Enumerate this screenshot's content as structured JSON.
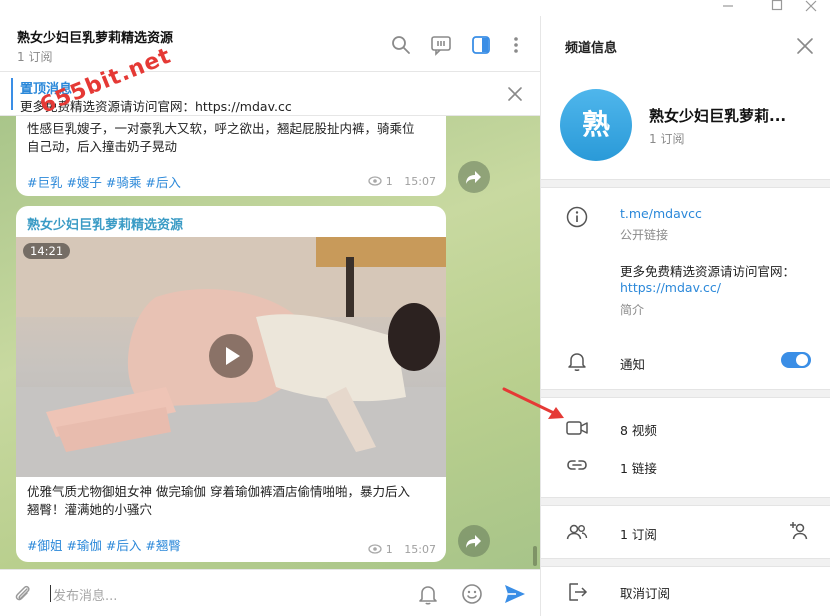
{
  "channel": {
    "title": "熟女少妇巨乳萝莉精选资源",
    "subscribers": "1 订阅",
    "short_name": "熟女少妇巨乳萝莉...",
    "avatar_letter": "熟"
  },
  "pinned": {
    "title": "置顶消息",
    "text": "更多免费精选资源请访问官网：https://mdav.cc"
  },
  "messages": [
    {
      "text_lines": [
        "性感巨乳嫂子，一对豪乳大又软，呼之欲出，翘起屁股扯内裤，骑乘位",
        "自己动，后入撞击奶子晃动"
      ],
      "tags": "#巨乳 #嫂子 #骑乘 #后入",
      "views": "1",
      "time": "15:07"
    },
    {
      "sender": "熟女少妇巨乳萝莉精选资源",
      "duration": "14:21",
      "text_lines": [
        "优雅气质尤物御姐女神 做完瑜伽 穿着瑜伽裤酒店偷情啪啪，暴力后入",
        "翘臀！灌满她的小骚穴"
      ],
      "tags": "#御姐 #瑜伽 #后入 #翘臀",
      "views": "1",
      "time": "15:07"
    }
  ],
  "composer": {
    "placeholder": "发布消息..."
  },
  "info_panel": {
    "title": "频道信息",
    "link": "t.me/mdavcc",
    "link_caption": "公开链接",
    "description": "更多免费精选资源请访问官网：",
    "description_link": "https://mdav.cc/",
    "description_caption": "简介",
    "notifications_label": "通知",
    "notifications_on": true,
    "videos": "8 视频",
    "links": "1 链接",
    "subscribers": "1 订阅",
    "leave": "取消订阅"
  },
  "watermark": "655bit.net",
  "colors": {
    "accent": "#3a8ee6",
    "link": "#2b88d9",
    "sender": "#3a9bc5",
    "arrow": "#e53935"
  },
  "icons": [
    "search-icon",
    "comments-icon",
    "sidebar-toggle-icon",
    "more-icon",
    "close-icon",
    "share-icon",
    "play-icon",
    "eye-icon",
    "attach-icon",
    "bell-icon",
    "emoji-icon",
    "send-icon",
    "info-icon",
    "video-icon",
    "link-icon",
    "users-icon",
    "add-user-icon",
    "leave-icon"
  ]
}
